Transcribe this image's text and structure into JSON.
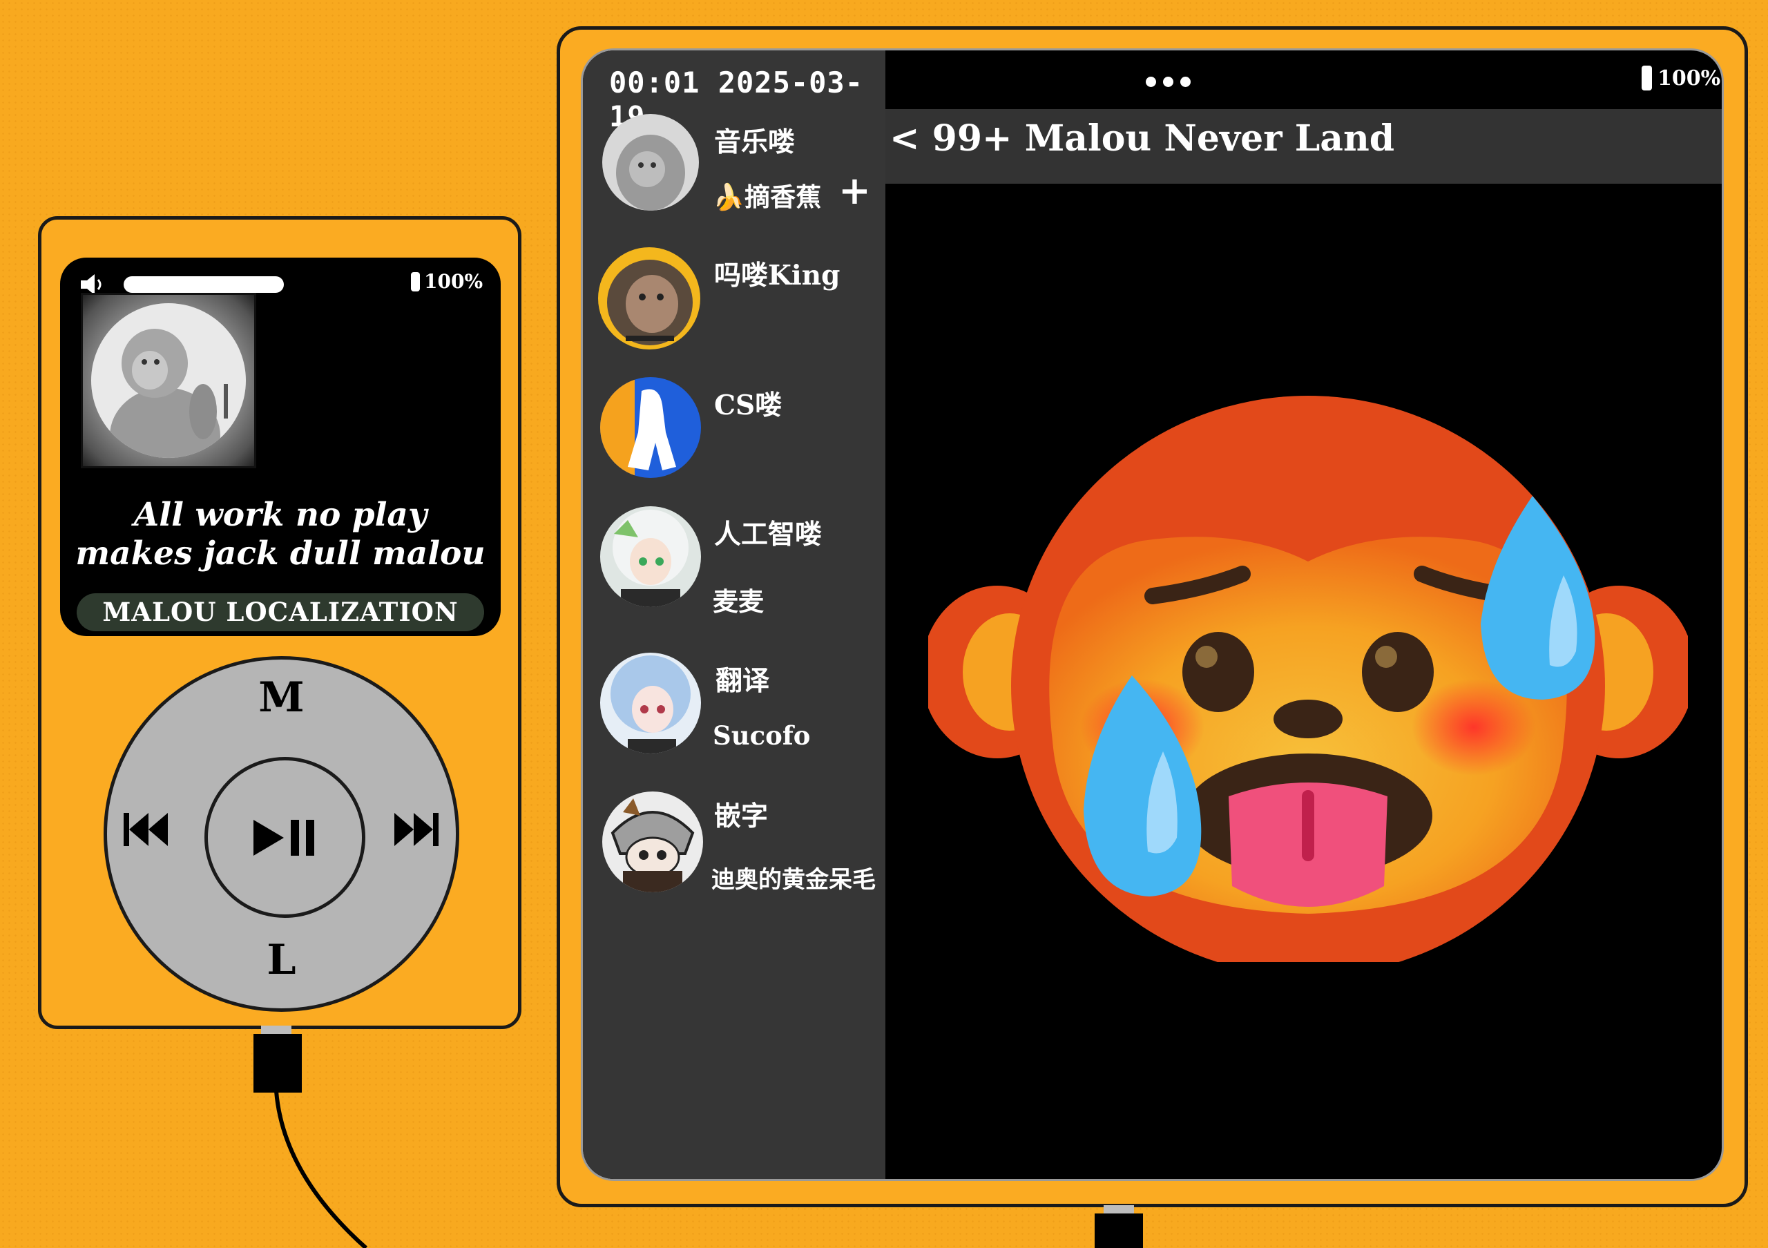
{
  "player": {
    "battery": "100%",
    "volume_level": 1.0,
    "lyric_line1": "All work no play",
    "lyric_line2": "makes jack dull malou",
    "brand": "MALOU LOCALIZATION",
    "wheel_top_label": "M",
    "wheel_bottom_label": "L",
    "icons": [
      "volume-icon",
      "battery-icon",
      "previous-icon",
      "play-pause-icon",
      "next-icon"
    ]
  },
  "tablet": {
    "time": "00:01 2025-03-19",
    "battery": "100%",
    "chat_title": "< 99+ Malou Never Land",
    "add_symbol": "+",
    "contacts": [
      {
        "name": "音乐喽",
        "sub": "🍌摘香蕉"
      },
      {
        "name": "吗喽King",
        "sub": ""
      },
      {
        "name": "CS喽",
        "sub": ""
      },
      {
        "name": "人工智喽",
        "sub": "麦麦"
      },
      {
        "name": "翻译",
        "sub": "Sucofo"
      },
      {
        "name": "嵌字",
        "sub": "迪奥的黄金呆毛"
      }
    ]
  },
  "colors": {
    "background": "#f8a91f",
    "device_body": "#fbab22",
    "screen": "#000000",
    "sidebar": "#363636",
    "wheel": "#b5b5b5",
    "emoji_face": "#e2491a",
    "emoji_sweat": "#45b6f2",
    "emoji_tongue": "#f0507c"
  }
}
